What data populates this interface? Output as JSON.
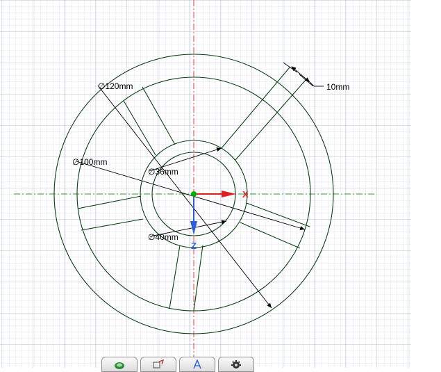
{
  "dimensions": {
    "outer_dia": "∅120mm",
    "inner_ring_dia": "∅100mm",
    "hub_outer_dia": "∅40mm",
    "hub_inner_dia": "∅36mm",
    "spoke_width": "10mm"
  },
  "axes": {
    "x_label": "X",
    "z_label": "Z"
  },
  "colors": {
    "grid_minor": "#c9cde6",
    "grid_major": "#a9add0",
    "geometry": "#0a4010",
    "centerline_vertical": "#e0393a",
    "centerline_horizontal": "#2e9a2e",
    "x_axis": "#e02020",
    "z_axis": "#2a5fd8",
    "origin": "#00b000"
  },
  "toolbar": {
    "buttons": [
      {
        "icon": "sketch-icon"
      },
      {
        "icon": "constraint-icon"
      },
      {
        "icon": "dimension-icon"
      },
      {
        "icon": "settings-gear-icon"
      }
    ]
  }
}
